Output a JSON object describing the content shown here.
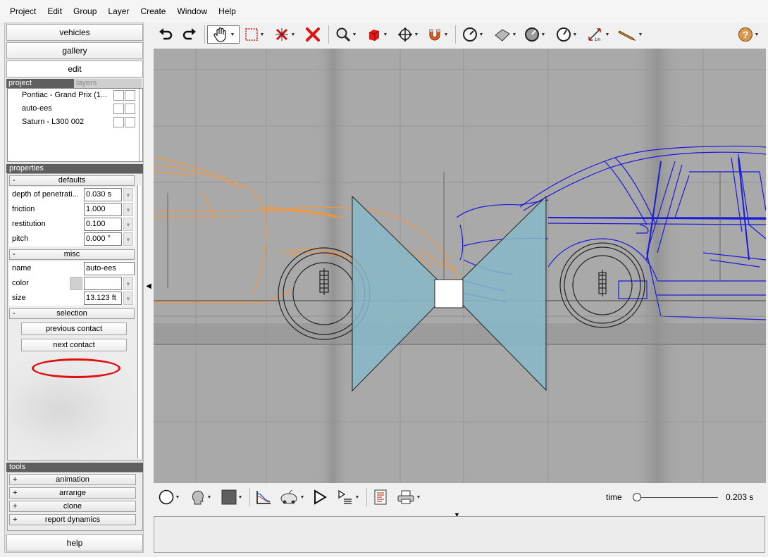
{
  "menu": [
    "Project",
    "Edit",
    "Group",
    "Layer",
    "Create",
    "Window",
    "Help"
  ],
  "nav": {
    "vehicles": "vehicles",
    "gallery": "gallery",
    "edit": "edit"
  },
  "tabs": {
    "project": "project",
    "layers": "layers"
  },
  "layers": [
    {
      "name": "Pontiac - Grand Prix (1..."
    },
    {
      "name": "auto-ees"
    },
    {
      "name": "Saturn - L300 002"
    }
  ],
  "properties": {
    "title": "properties",
    "defaults": {
      "header": "defaults",
      "rows": [
        {
          "label": "depth of penetrati...",
          "value": "0.030 s"
        },
        {
          "label": "friction",
          "value": "1.000"
        },
        {
          "label": "restitution",
          "value": "0.100"
        },
        {
          "label": "pitch",
          "value": "0.000 °"
        }
      ]
    },
    "misc": {
      "header": "misc",
      "name_label": "name",
      "name_value": "auto-ees",
      "color_label": "color",
      "color_value": "",
      "size_label": "size",
      "size_value": "13.123 ft"
    },
    "selection": {
      "header": "selection",
      "previous": "previous contact",
      "next": "next contact"
    }
  },
  "tools": {
    "title": "tools",
    "items": [
      "animation",
      "arrange",
      "clone",
      "report dynamics"
    ]
  },
  "help": "help",
  "time": {
    "label": "time",
    "value": "0.203 s",
    "position": 0.0
  },
  "colors": {
    "vehicle_left": "#f4963c",
    "vehicle_right": "#1a1adc",
    "contact_plane": "#87b8c8",
    "highlight": "#e01010"
  }
}
